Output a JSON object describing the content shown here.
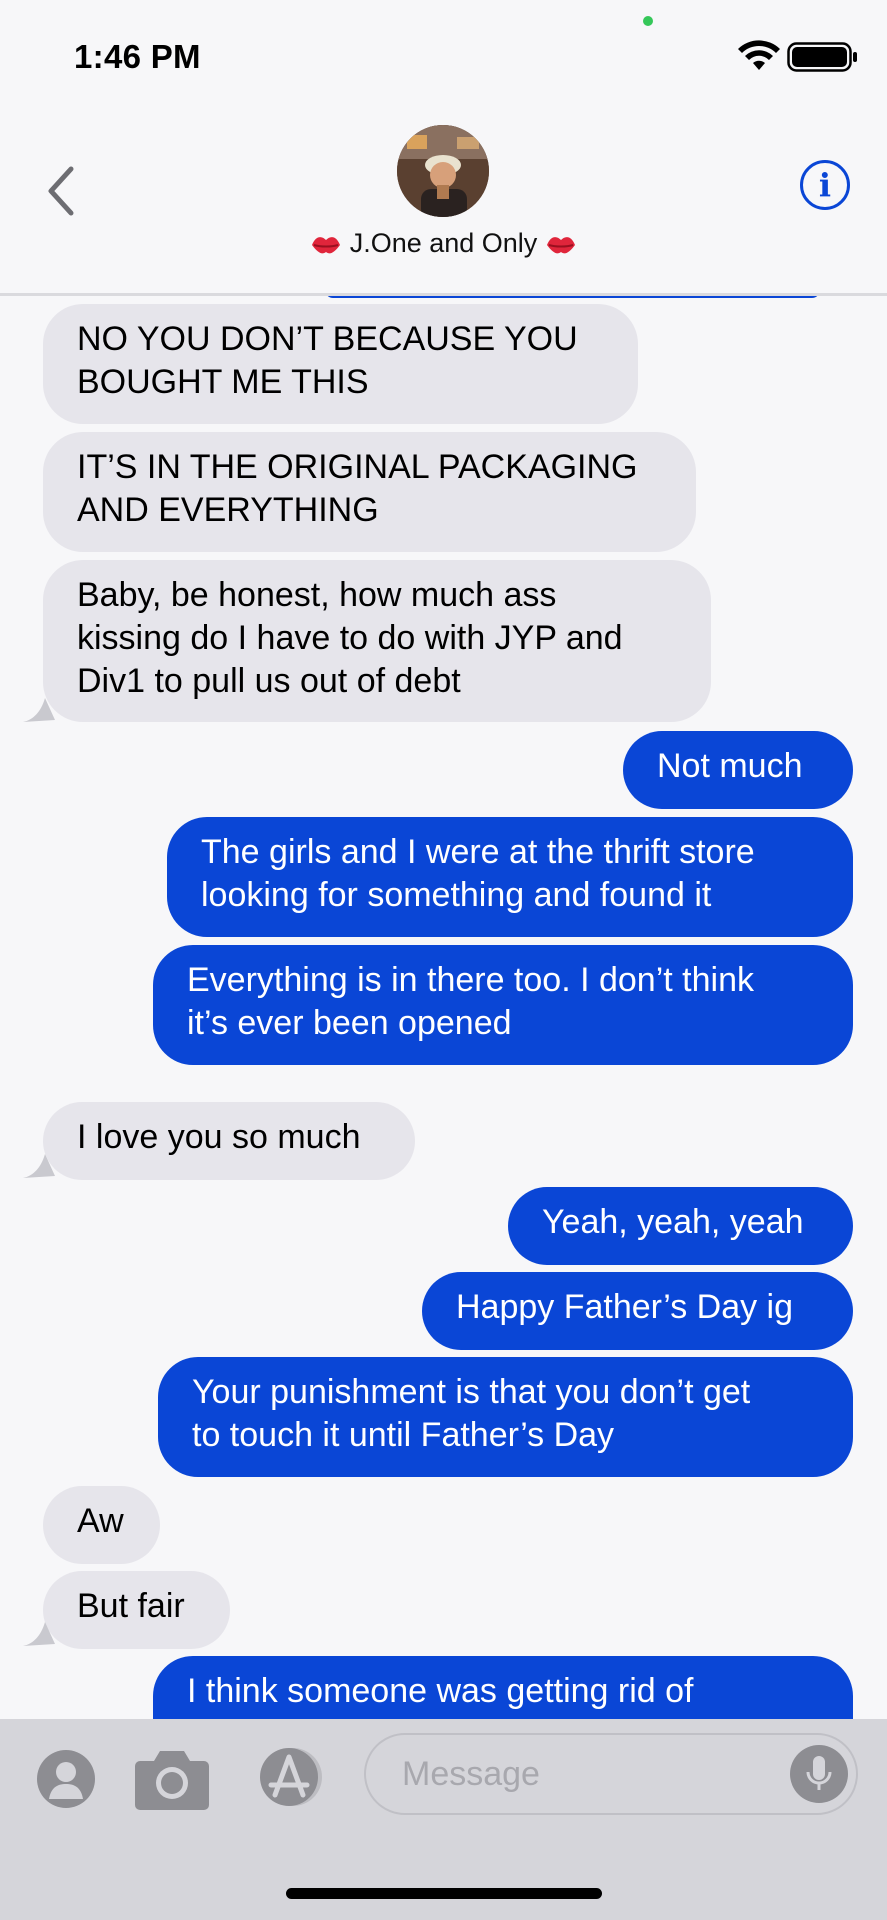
{
  "status_bar": {
    "time": "1:46 PM"
  },
  "header": {
    "contact_name": "J.One and Only",
    "back_icon": "chevron-left-icon",
    "info_icon": "info-icon",
    "info_label": "i"
  },
  "messages": [
    {
      "direction": "incoming",
      "text": "NO YOU DON’T BECAUSE YOU\nBOUGHT ME THIS"
    },
    {
      "direction": "incoming",
      "text": "IT’S IN THE ORIGINAL PACKAGING\nAND EVERYTHING"
    },
    {
      "direction": "incoming",
      "text": "Baby, be honest, how much ass\nkissing do I have to do with JYP and\nDiv1 to pull us out of debt"
    },
    {
      "direction": "outgoing",
      "text": "Not much"
    },
    {
      "direction": "outgoing",
      "text": "The girls and I were at the thrift store\nlooking for something and found it"
    },
    {
      "direction": "outgoing",
      "text": "Everything is in there too. I don’t think\nit’s ever been opened"
    },
    {
      "direction": "incoming",
      "text": "I love you so much"
    },
    {
      "direction": "outgoing",
      "text": "Yeah, yeah, yeah"
    },
    {
      "direction": "outgoing",
      "text": "Happy Father’s Day ig"
    },
    {
      "direction": "outgoing",
      "text": "Your punishment is that you don’t get\nto touch it until Father’s Day"
    },
    {
      "direction": "incoming",
      "text": "Aw"
    },
    {
      "direction": "incoming",
      "text": "But fair"
    },
    {
      "direction": "outgoing",
      "text": "I think someone was getting rid of"
    }
  ],
  "input_bar": {
    "placeholder": "Message",
    "buttons": [
      "contacts-icon",
      "camera-icon",
      "app-store-icon",
      "microphone-icon"
    ]
  },
  "colors": {
    "outgoing_bubble": "#0a46d6",
    "incoming_bubble": "#e6e5eb",
    "background": "#f7f7f9"
  }
}
